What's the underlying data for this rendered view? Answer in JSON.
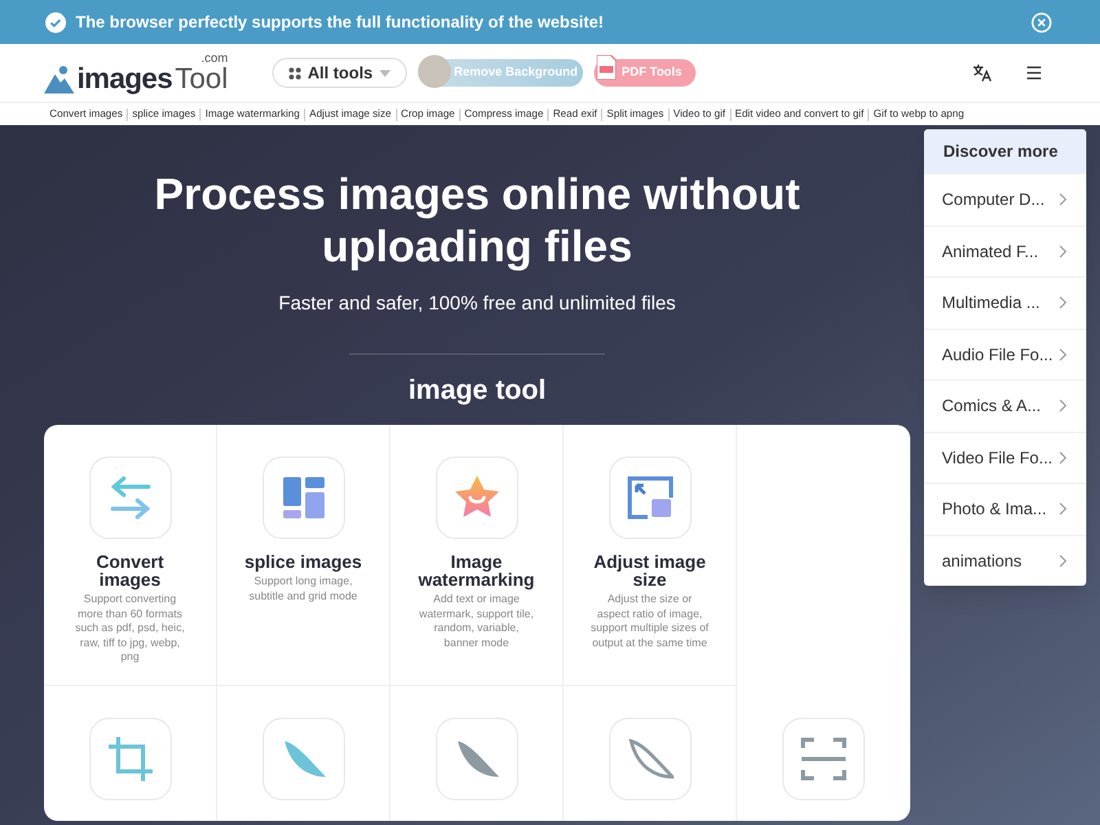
{
  "banner": {
    "message": "The browser perfectly supports the full functionality of the website!"
  },
  "header": {
    "logo": {
      "text": "images",
      "suffix": "Tool",
      "domain": ".com"
    },
    "all_tools": "All tools",
    "remove_background": "Remove Background",
    "pdf_tools": "PDF Tools"
  },
  "nav_links": [
    "Convert images",
    "splice images",
    "Image watermarking",
    "Adjust image size",
    "Crop image",
    "Compress image",
    "Read exif",
    "Split images",
    "Video to gif",
    "Edit video and convert to gif",
    "Gif to webp to apng"
  ],
  "hero": {
    "title": "Process images online without uploading files",
    "subtitle": "Faster and safer, 100% free and unlimited files",
    "section_title": "image tool"
  },
  "tools": [
    {
      "kind": "convert",
      "title": "Convert images",
      "description": "Support converting more than 60 formats such as pdf, psd, heic, raw, tiff to jpg, webp, png"
    },
    {
      "kind": "splice",
      "title": "splice images",
      "description": "Support long image, subtitle and grid mode"
    },
    {
      "kind": "watermark",
      "title": "Image watermarking",
      "description": "Add text or image watermark, support tile, random, variable, banner mode"
    },
    {
      "kind": "resize",
      "title": "Adjust image size",
      "description": "Adjust the size or aspect ratio of image, support multiple sizes of output at the same time"
    },
    {
      "kind": "empty"
    },
    {
      "kind": "crop"
    },
    {
      "kind": "compress_teal"
    },
    {
      "kind": "compress_gray"
    },
    {
      "kind": "compress_outline"
    },
    {
      "kind": "exif"
    }
  ],
  "discover_menu": {
    "title": "Discover more",
    "items": [
      "Computer D...",
      "Animated F...",
      "Multimedia ...",
      "Audio File Fo...",
      "Comics & A...",
      "Video File Fo...",
      "Photo & Ima...",
      "animations"
    ]
  }
}
